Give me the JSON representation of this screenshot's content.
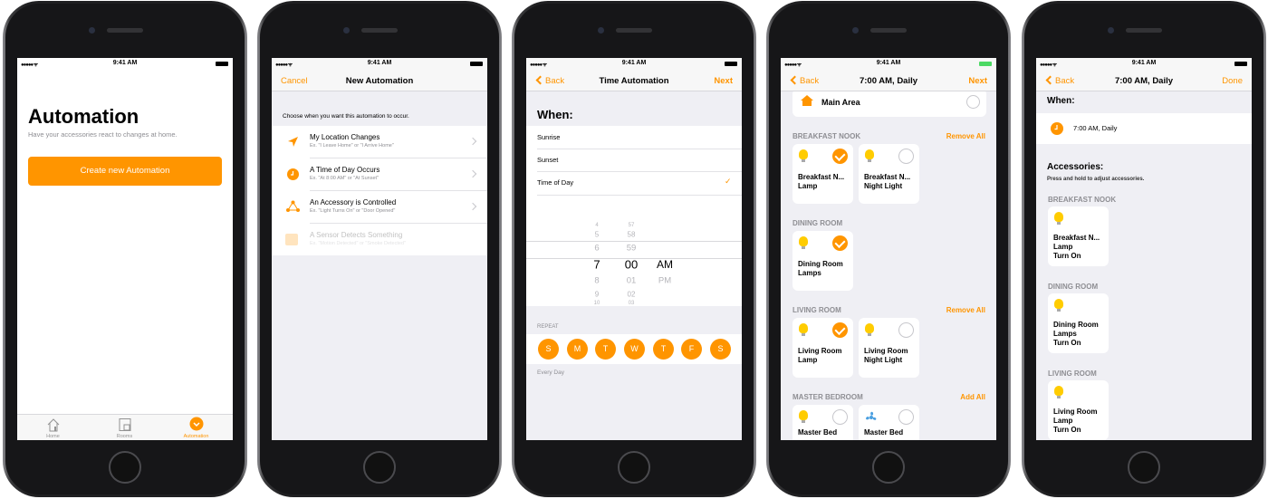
{
  "status": {
    "time": "9:41 AM",
    "signal": "●●●●● ᯤ"
  },
  "colors": {
    "accent": "#ff9500",
    "bulb": "#ffcc00",
    "battery_charging": "#4cd964",
    "background": "#efeff4"
  },
  "screen1": {
    "title": "Automation",
    "subtitle": "Have your accessories react to changes at home.",
    "create_button": "Create new Automation",
    "tabs": [
      {
        "label": "Home",
        "icon": "house-icon",
        "active": false
      },
      {
        "label": "Rooms",
        "icon": "rooms-icon",
        "active": false
      },
      {
        "label": "Automation",
        "icon": "automation-icon",
        "active": true
      }
    ]
  },
  "screen2": {
    "nav": {
      "cancel": "Cancel",
      "title": "New Automation"
    },
    "section_header": "Choose when you want this automation to occur.",
    "triggers": [
      {
        "title": "My Location Changes",
        "subtitle": "Ex. \"I Leave Home\" or \"I Arrive Home\"",
        "icon": "location-arrow-icon",
        "enabled": true
      },
      {
        "title": "A Time of Day Occurs",
        "subtitle": "Ex. \"At 8:00 AM\" or \"At Sunset\"",
        "icon": "clock-icon",
        "enabled": true
      },
      {
        "title": "An Accessory is Controlled",
        "subtitle": "Ex. \"Light Turns On\" or \"Door Opened\"",
        "icon": "accessory-network-icon",
        "enabled": true
      },
      {
        "title": "A Sensor Detects Something",
        "subtitle": "Ex. \"Motion Detected\" or \"Smoke Detected\"",
        "icon": "sensor-icon",
        "enabled": false
      }
    ]
  },
  "screen3": {
    "nav": {
      "back": "Back",
      "title": "Time Automation",
      "next": "Next"
    },
    "when_label": "When:",
    "options": [
      {
        "label": "Sunrise",
        "selected": false
      },
      {
        "label": "Sunset",
        "selected": false
      },
      {
        "label": "Time of Day",
        "selected": true
      }
    ],
    "picker": {
      "hours": [
        "4",
        "5",
        "6",
        "7",
        "8",
        "9",
        "10"
      ],
      "minutes": [
        "57",
        "58",
        "59",
        "00",
        "01",
        "02",
        "03"
      ],
      "period": [
        "AM",
        "PM"
      ],
      "selected": {
        "hour": "7",
        "minute": "00",
        "period": "AM"
      }
    },
    "repeat_label": "REPEAT",
    "days": [
      "S",
      "M",
      "T",
      "W",
      "T",
      "F",
      "S"
    ],
    "repeat_summary": "Every Day"
  },
  "screen4": {
    "nav": {
      "back": "Back",
      "title": "7:00 AM, Daily",
      "next": "Next"
    },
    "home": {
      "label": "Main Area",
      "selected": false
    },
    "rooms": [
      {
        "name": "BREAKFAST NOOK",
        "action": "Remove All",
        "accessories": [
          {
            "lines": [
              "Breakfast N...",
              "Lamp"
            ],
            "type": "bulb",
            "selected": true
          },
          {
            "lines": [
              "Breakfast N...",
              "Night Light"
            ],
            "type": "bulb",
            "selected": false
          }
        ]
      },
      {
        "name": "DINING ROOM",
        "action": "",
        "accessories": [
          {
            "lines": [
              "Dining Room",
              "Lamps"
            ],
            "type": "bulb",
            "selected": true
          }
        ]
      },
      {
        "name": "LIVING ROOM",
        "action": "Remove All",
        "accessories": [
          {
            "lines": [
              "Living Room",
              "Lamp"
            ],
            "type": "bulb",
            "selected": true
          },
          {
            "lines": [
              "Living Room",
              "Night Light"
            ],
            "type": "bulb",
            "selected": false
          }
        ]
      },
      {
        "name": "MASTER BEDROOM",
        "action": "Add All",
        "accessories": [
          {
            "lines": [
              "Master Bed"
            ],
            "type": "bulb",
            "selected": false
          },
          {
            "lines": [
              "Master Bed"
            ],
            "type": "fan",
            "selected": false
          }
        ]
      }
    ]
  },
  "screen5": {
    "nav": {
      "back": "Back",
      "title": "7:00 AM, Daily",
      "done": "Done"
    },
    "when_label": "When:",
    "when_value": "7:00 AM, Daily",
    "accessories_label": "Accessories:",
    "accessories_hint": "Press and hold to adjust accessories.",
    "rooms": [
      {
        "name": "BREAKFAST NOOK",
        "accessory": {
          "lines": [
            "Breakfast N...",
            "Lamp",
            "Turn On"
          ]
        }
      },
      {
        "name": "DINING ROOM",
        "accessory": {
          "lines": [
            "Dining Room",
            "Lamps",
            "Turn On"
          ]
        }
      },
      {
        "name": "LIVING ROOM",
        "accessory": {
          "lines": [
            "Living Room",
            "Lamp",
            "Turn On"
          ]
        }
      }
    ]
  }
}
